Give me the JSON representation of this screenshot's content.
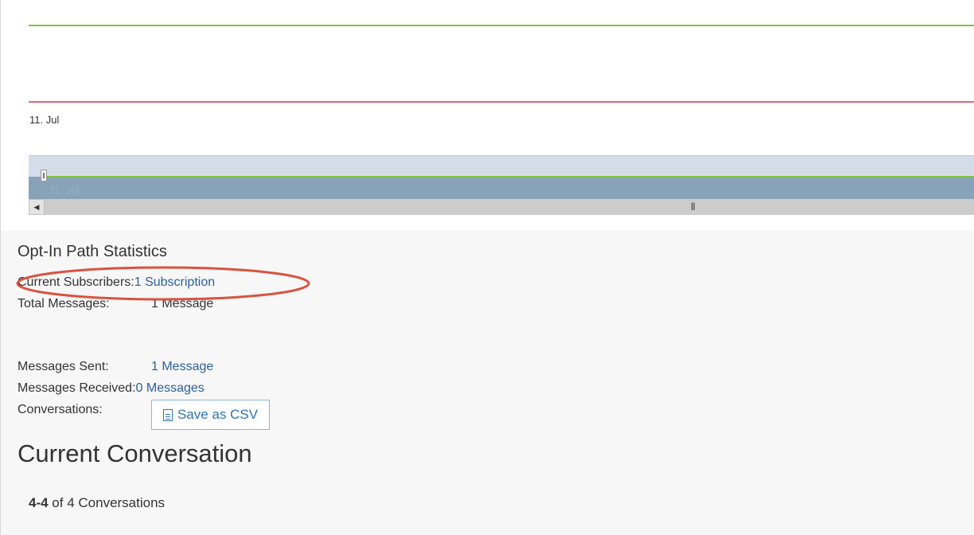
{
  "chart": {
    "x_tick_label": "11. Jul",
    "navigator_tick_label": "11. Jul",
    "colors": {
      "green_series": "#7cc242",
      "red_series": "#d9677f",
      "navigator_fill": "#88a3b8"
    },
    "scroll_left_icon": "triangle-left-icon",
    "scroll_grip_icon": "grip-icon"
  },
  "stats": {
    "title": "Opt-In Path Statistics",
    "current_subscribers_label": "Current Subscribers:",
    "current_subscribers_value": "1 Subscription",
    "total_messages_label": "Total Messages:",
    "total_messages_value": "1 Message",
    "messages_sent_label": "Messages Sent:",
    "messages_sent_value": "1 Message",
    "messages_received_label": "Messages Received:",
    "messages_received_value": "0 Messages",
    "conversations_label": "Conversations:",
    "save_csv_label": "Save as CSV"
  },
  "conversation": {
    "heading": "Current Conversation",
    "range": "4-4",
    "of_text": " of 4 Conversations"
  }
}
